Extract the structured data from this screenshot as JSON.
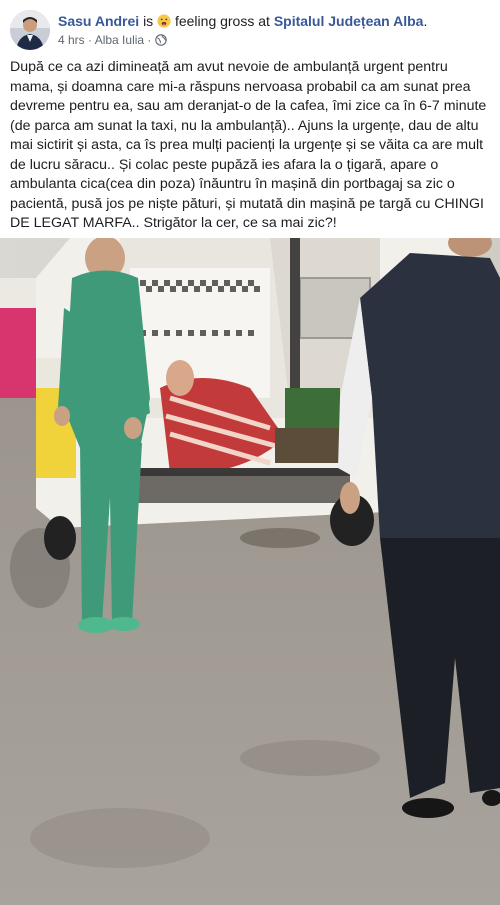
{
  "post": {
    "author": "Sasu Andrei",
    "is_word": "is",
    "feeling_text": "feeling gross at",
    "place": "Spitalul Județean Alba",
    "period": ".",
    "time": "4 hrs",
    "separator": "·",
    "location": "Alba Iulia",
    "message": "După ce ca azi dimineață am avut nevoie de ambulanță urgent pentru mama, și doamna care mi-a răspuns nervoasa probabil ca am sunat prea devreme pentru ea, sau am deranjat-o de la cafea, îmi zice ca în 6-7 minute (de parca am sunat la taxi, nu la ambulanță).. Ajuns la urgențe, dau de altu mai sictirit și asta, ca îs prea mulți pacienți la urgențe și se văita ca are mult de lucru săracu.. Și colac peste pupăză ies afara la o țigară, apare o ambulanta cica(cea din poza) înăuntru în mașină din portbagaj sa zic o pacientă, pusă jos pe niște pături, și mutată din mașină pe targă cu CHINGI DE LEGAT MARFA.. Strigător la cer, ce sa mai zic?!"
  },
  "icons": {
    "avatar": "profile-photo",
    "feeling": "gross-face-emoji",
    "privacy": "globe-icon"
  },
  "colors": {
    "link": "#385898",
    "meta": "#606770",
    "text": "#1c1e21"
  }
}
